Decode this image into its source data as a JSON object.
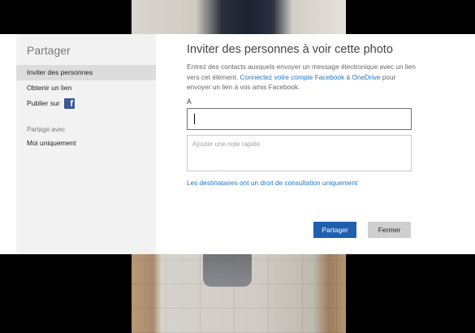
{
  "sidebar": {
    "title": "Partager",
    "items": [
      {
        "label": "Inviter des personnes"
      },
      {
        "label": "Obtenir un lien"
      },
      {
        "label": "Publier sur"
      }
    ],
    "facebook_glyph": "f",
    "section_label": "Partagé avec",
    "shared_with": "Moi uniquement"
  },
  "main": {
    "title": "Inviter des personnes à voir cette photo",
    "description_part1": "Entrez des contacts auxquels envoyer un message électronique avec un lien vers cet élément. ",
    "description_link": "Connectez votre compte Facebook à OneDrive",
    "description_part2": " pour envoyer un lien à vos amis Facebook.",
    "to_label": "À",
    "to_value": "",
    "note_placeholder": "Ajouter une note rapide",
    "permission_link": "Les destinataires ont un droit de consultation uniquement",
    "share_button": "Partager",
    "close_button": "Fermer"
  },
  "colors": {
    "accent": "#1f5fb0",
    "link": "#1c76c9",
    "facebook": "#3b5998",
    "sidebar_bg": "#f2f2f2",
    "backdrop": "#000000"
  }
}
